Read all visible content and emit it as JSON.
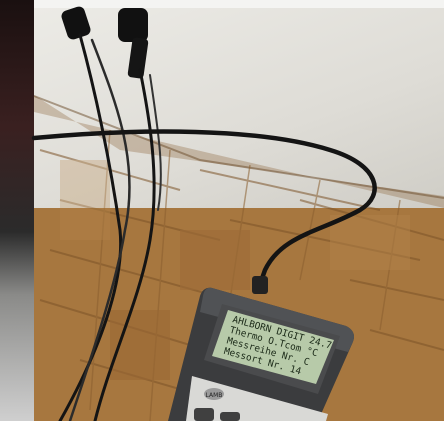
{
  "device": {
    "brand": "LAMB",
    "display_lines": [
      "AHLBORN DIGIT  24.7",
      "Thermo O.Tcom  °C",
      "Messreihe Nr.   C",
      "Messort Nr.    14"
    ]
  },
  "colors": {
    "wall": "#e6e5df",
    "parquet": "#a7773f",
    "parquet_dark": "#8a5f2f",
    "cable": "#141414",
    "device_body": "#3b3c3e",
    "lcd_background": "#b7caa9"
  }
}
